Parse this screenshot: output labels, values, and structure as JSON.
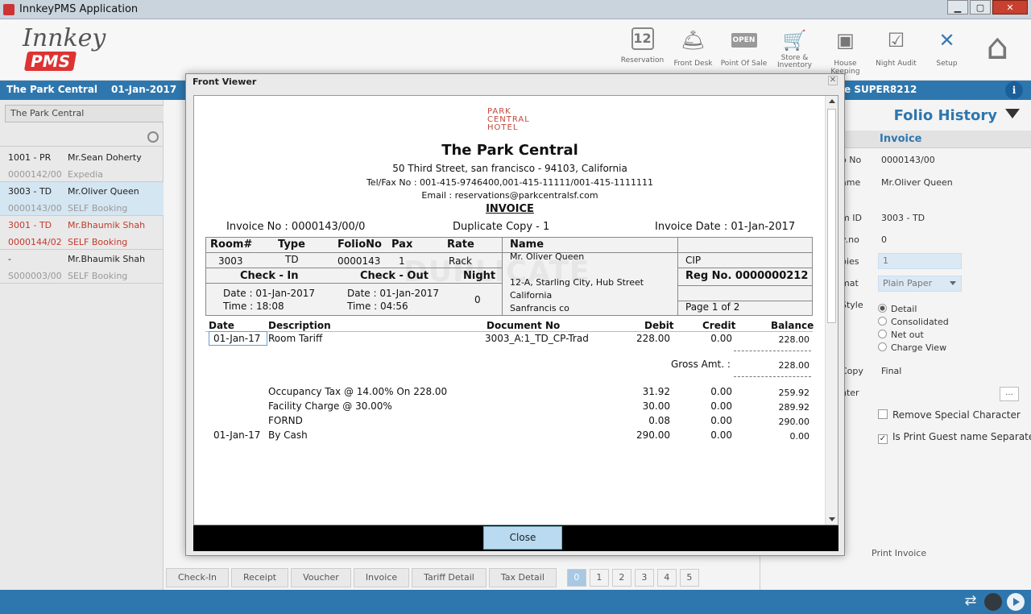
{
  "window": {
    "title": "InnkeyPMS Application"
  },
  "header": {
    "logo_text": "Innkey PMS",
    "nav": [
      {
        "label": "Reservation",
        "icon": "calendar-icon",
        "glyph": "12"
      },
      {
        "label": "Front Desk",
        "icon": "bell-icon",
        "glyph": "🛎"
      },
      {
        "label": "Point Of Sale",
        "icon": "open-sign-icon",
        "glyph": "OPEN"
      },
      {
        "label": "Store & Inventory",
        "icon": "cart-icon",
        "glyph": "🛒"
      },
      {
        "label": "House Keeping",
        "icon": "wallet-icon",
        "glyph": "▣"
      },
      {
        "label": "Night Audit",
        "icon": "checklist-icon",
        "glyph": "☑"
      },
      {
        "label": "Setup",
        "icon": "tools-icon",
        "glyph": "✕"
      }
    ],
    "home_icon": "home-icon"
  },
  "bluebar": {
    "property": "The Park Central",
    "date": "01-Jan-2017",
    "user": "e SUPER8212"
  },
  "left": {
    "property_select": "The Park Central",
    "guests": [
      {
        "room": "1001 - PR",
        "name": "Mr.Sean Doherty",
        "folio": "0000142/00",
        "source": "Expedia",
        "style": "normal"
      },
      {
        "room": "3003 - TD",
        "name": "Mr.Oliver Queen",
        "folio": "0000143/00",
        "source": "SELF Booking",
        "style": "selected"
      },
      {
        "room": "3001 - TD",
        "name": "Mr.Bhaumik Shah",
        "folio": "0000144/02",
        "source": "SELF Booking",
        "style": "red"
      },
      {
        "room": "-",
        "name": "Mr.Bhaumik Shah",
        "folio": "S000003/00",
        "source": "SELF Booking",
        "style": "normal"
      }
    ]
  },
  "right": {
    "title": "Folio History",
    "section": "Invoice",
    "fields": [
      {
        "label": "o No",
        "value": "0000143/00"
      },
      {
        "label": "ame",
        "value": "Mr.Oliver Queen"
      },
      {
        "label": "m ID",
        "value": "3003 - TD"
      },
      {
        "label": "v.no",
        "value": "0"
      }
    ],
    "copies_label": "pies",
    "copies_value": "1",
    "format_label": "mat",
    "format_value": "Plain Paper",
    "style_label": "Style",
    "style_options": [
      "Detail",
      "Consolidated",
      "Net out",
      "Charge View"
    ],
    "copy_label": "Copy",
    "copy_value": "Final",
    "printer_label": "nter",
    "printer_btn": "...",
    "remove_special": "Remove Special Character",
    "print_guest": "Is Print Guest name Separately",
    "print_invoice": "Print Invoice"
  },
  "bottom_tabs": [
    "Check-In",
    "Receipt",
    "Voucher",
    "Invoice",
    "Tariff Detail",
    "Tax Detail"
  ],
  "pages": [
    "0",
    "1",
    "2",
    "3",
    "4",
    "5"
  ],
  "modal": {
    "title": "Front Viewer",
    "close_label": "Close",
    "invoice": {
      "logo_lines": [
        "PARK",
        "CENTRAL",
        "HOTEL"
      ],
      "hotel_name": "The Park Central",
      "address": "50 Third Street, san francisco - 94103, California",
      "telfax": "Tel/Fax No : 001-415-9746400,001-415-11111/001-415-1111111",
      "email": "Email : reservations@parkcentralsf.com",
      "doc_title": "INVOICE",
      "invoice_no": "Invoice No : 0000143/00/0",
      "copy_note": "Duplicate Copy - 1",
      "invoice_date": "Invoice Date : 01-Jan-2017",
      "watermark": "DUPLICATE",
      "box": {
        "h_room": "Room#",
        "h_type": "Type",
        "h_folio": "FolioNo",
        "h_pax": "Pax",
        "h_rate": "Rate",
        "h_name": "Name",
        "room": "3003",
        "type": "TD",
        "folio": "0000143",
        "pax": "1",
        "rate": "Rack",
        "h_checkin": "Check - In",
        "h_checkout": "Check - Out",
        "h_night": "Night",
        "ci_date": "Date : 01-Jan-2017",
        "ci_time": "Time : 18:08",
        "co_date": "Date : 01-Jan-2017",
        "co_time": "Time : 04:56",
        "night": "0",
        "guest_name": "Mr. Oliver Queen",
        "addr1": "12-A, Starling City, Hub Street",
        "addr2": "California",
        "addr3": "Sanfrancis co",
        "cip": "CIP",
        "reg": "Reg No. 0000000212",
        "page": "Page 1 of 2"
      },
      "columns": [
        "Date",
        "Description",
        "Document No",
        "Debit",
        "Credit",
        "Balance"
      ],
      "rows": [
        {
          "date": "01-Jan-17",
          "desc": "Room Tariff",
          "doc": "3003_A:1_TD_CP-Trad",
          "debit": "228.00",
          "credit": "0.00",
          "balance": "228.00"
        }
      ],
      "gross_label": "Gross Amt. :",
      "gross_value": "228.00",
      "tax_rows": [
        {
          "date": "",
          "desc": "Occupancy Tax @ 14.00% On 228.00",
          "debit": "31.92",
          "credit": "0.00",
          "balance": "259.92"
        },
        {
          "date": "",
          "desc": "Facility Charge @ 30.00%",
          "debit": "30.00",
          "credit": "0.00",
          "balance": "289.92"
        },
        {
          "date": "",
          "desc": "FORND",
          "debit": "0.08",
          "credit": "0.00",
          "balance": "290.00"
        },
        {
          "date": "01-Jan-17",
          "desc": "By Cash",
          "debit": "290.00",
          "credit": "0.00",
          "balance": "0.00"
        }
      ]
    }
  }
}
